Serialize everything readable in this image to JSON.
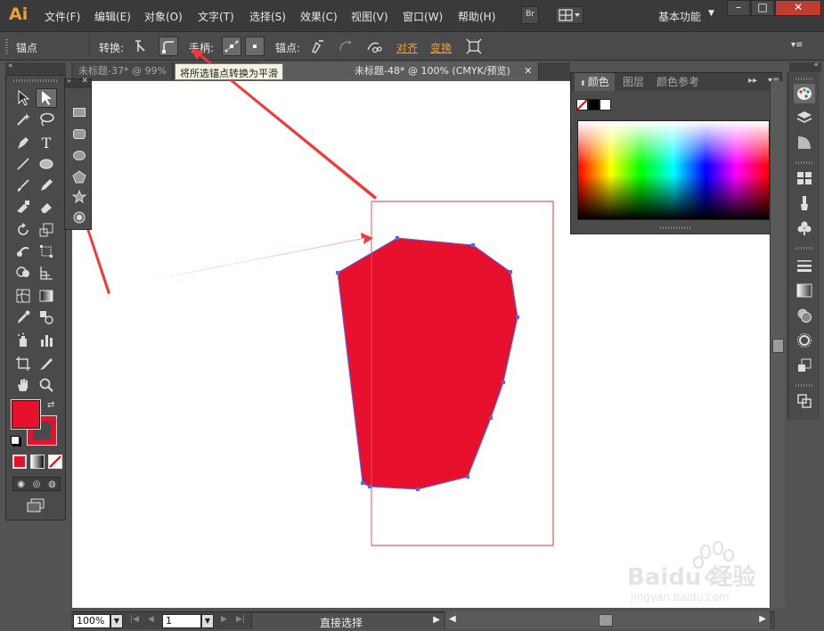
{
  "app": {
    "logo": "Ai",
    "workspace": "基本功能"
  },
  "menu": [
    {
      "label": "文件(F)"
    },
    {
      "label": "编辑(E)"
    },
    {
      "label": "对象(O)"
    },
    {
      "label": "文字(T)"
    },
    {
      "label": "选择(S)"
    },
    {
      "label": "效果(C)"
    },
    {
      "label": "视图(V)"
    },
    {
      "label": "窗口(W)"
    },
    {
      "label": "帮助(H)"
    }
  ],
  "bridge_label": "Br",
  "window_controls": {
    "minimize": "–",
    "maximize": "□",
    "close": "✕"
  },
  "controlbar": {
    "anchor_label": "锚点",
    "convert_label": "转换:",
    "handles_label": "手柄:",
    "anchors_label": "锚点:",
    "align_link": "对齐",
    "transform_link": "变换"
  },
  "tooltip": "将所选锚点转换为平滑",
  "tabs": [
    {
      "label": "未标题-37* @ 99%"
    },
    {
      "label": "未标题-48* @ 100% (CMYK/预览)"
    }
  ],
  "tab_close": "✕",
  "color_panel": {
    "tabs": [
      {
        "label": "颜色"
      },
      {
        "label": "图层"
      },
      {
        "label": "颜色参考"
      }
    ],
    "fill_color": "#e8112d",
    "stroke_color": "#e8112d"
  },
  "statusbar": {
    "zoom": "100%",
    "artboard": "1",
    "tool_name": "直接选择"
  },
  "watermark": {
    "brand": "Baidu 经验",
    "url": "jingyan.baidu.com"
  },
  "colors": {
    "shape_fill": "#e8112d",
    "selection": "#4a6cf5",
    "artboard_border": "#e0303a",
    "arrow": "#f03a3a",
    "accent": "#f29c27"
  }
}
